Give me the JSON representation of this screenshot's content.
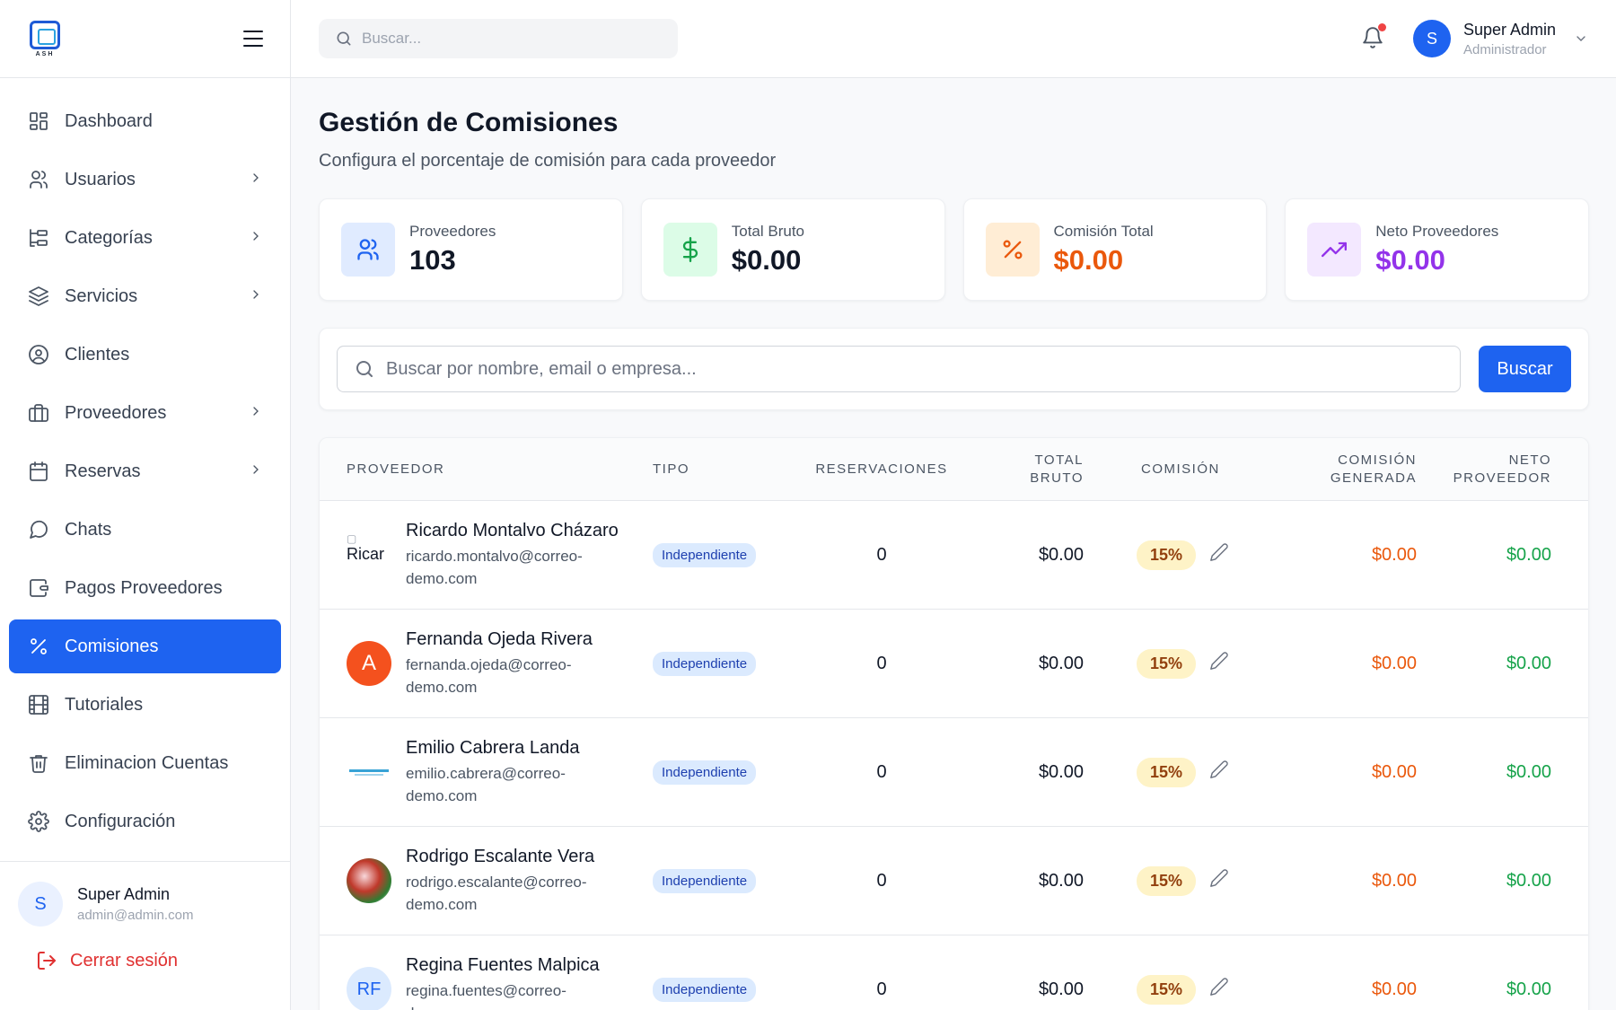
{
  "brand": {
    "logo_text": "ASH"
  },
  "sidebar": {
    "items": [
      {
        "label": "Dashboard",
        "icon": "dashboard-icon",
        "chevron": false,
        "active": false
      },
      {
        "label": "Usuarios",
        "icon": "users-icon",
        "chevron": true,
        "active": false
      },
      {
        "label": "Categorías",
        "icon": "categories-icon",
        "chevron": true,
        "active": false
      },
      {
        "label": "Servicios",
        "icon": "layers-icon",
        "chevron": true,
        "active": false
      },
      {
        "label": "Clientes",
        "icon": "user-circle-icon",
        "chevron": false,
        "active": false
      },
      {
        "label": "Proveedores",
        "icon": "briefcase-icon",
        "chevron": true,
        "active": false
      },
      {
        "label": "Reservas",
        "icon": "calendar-icon",
        "chevron": true,
        "active": false
      },
      {
        "label": "Chats",
        "icon": "chat-icon",
        "chevron": false,
        "active": false
      },
      {
        "label": "Pagos Proveedores",
        "icon": "wallet-icon",
        "chevron": false,
        "active": false
      },
      {
        "label": "Comisiones",
        "icon": "percent-icon",
        "chevron": false,
        "active": true
      },
      {
        "label": "Tutoriales",
        "icon": "film-icon",
        "chevron": false,
        "active": false
      },
      {
        "label": "Eliminacion Cuentas",
        "icon": "trash-icon",
        "chevron": false,
        "active": false
      },
      {
        "label": "Configuración",
        "icon": "gear-icon",
        "chevron": false,
        "active": false
      }
    ],
    "user": {
      "initial": "S",
      "name": "Super Admin",
      "email": "admin@admin.com"
    },
    "logout_label": "Cerrar sesión"
  },
  "header": {
    "search_placeholder": "Buscar...",
    "user": {
      "initial": "S",
      "name": "Super Admin",
      "role": "Administrador"
    }
  },
  "page": {
    "title": "Gestión de Comisiones",
    "subtitle": "Configura el porcentaje de comisión para cada proveedor"
  },
  "stats": [
    {
      "label": "Proveedores",
      "value": "103",
      "icon": "users-icon",
      "icon_bg": "#e0ebff",
      "icon_color": "#1e63f0",
      "value_color": "#111827"
    },
    {
      "label": "Total Bruto",
      "value": "$0.00",
      "icon": "dollar-icon",
      "icon_bg": "#dcfce7",
      "icon_color": "#16a34a",
      "value_color": "#111827"
    },
    {
      "label": "Comisión Total",
      "value": "$0.00",
      "icon": "percent-icon",
      "icon_bg": "#ffedd5",
      "icon_color": "#ea580c",
      "value_color": "#ea580c"
    },
    {
      "label": "Neto Proveedores",
      "value": "$0.00",
      "icon": "trending-up-icon",
      "icon_bg": "#f3e8ff",
      "icon_color": "#9333ea",
      "value_color": "#9333ea"
    }
  ],
  "filter": {
    "search_placeholder": "Buscar por nombre, email o empresa...",
    "button_label": "Buscar"
  },
  "table": {
    "headers": {
      "proveedor": "PROVEEDOR",
      "tipo": "TIPO",
      "reservaciones": "RESERVACIONES",
      "total_bruto_1": "TOTAL",
      "total_bruto_2": "BRUTO",
      "comision": "COMISIÓN",
      "comision_generada_1": "COMISIÓN",
      "comision_generada_2": "GENERADA",
      "neto_1": "NETO",
      "neto_2": "PROVEEDOR"
    },
    "rows": [
      {
        "name": "Ricardo Montalvo Cházaro",
        "email": "ricardo.montalvo@correo-demo.com",
        "avatar_type": "broken",
        "avatar_text": "Ricar",
        "tipo": "Independiente",
        "reservaciones": "0",
        "total_bruto": "$0.00",
        "comision": "15%",
        "comision_generada": "$0.00",
        "neto": "$0.00"
      },
      {
        "name": "Fernanda Ojeda Rivera",
        "email": "fernanda.ojeda@correo-demo.com",
        "avatar_type": "letter",
        "avatar_text": "A",
        "tipo": "Independiente",
        "reservaciones": "0",
        "total_bruto": "$0.00",
        "comision": "15%",
        "comision_generada": "$0.00",
        "neto": "$0.00"
      },
      {
        "name": "Emilio Cabrera Landa",
        "email": "emilio.cabrera@correo-demo.com",
        "avatar_type": "logo",
        "avatar_text": "",
        "tipo": "Independiente",
        "reservaciones": "0",
        "total_bruto": "$0.00",
        "comision": "15%",
        "comision_generada": "$0.00",
        "neto": "$0.00"
      },
      {
        "name": "Rodrigo Escalante Vera",
        "email": "rodrigo.escalante@correo-demo.com",
        "avatar_type": "photo",
        "avatar_text": "",
        "tipo": "Independiente",
        "reservaciones": "0",
        "total_bruto": "$0.00",
        "comision": "15%",
        "comision_generada": "$0.00",
        "neto": "$0.00"
      },
      {
        "name": "Regina Fuentes Malpica",
        "email": "regina.fuentes@correo-demo.com",
        "avatar_type": "initials",
        "avatar_text": "RF",
        "tipo": "Independiente",
        "reservaciones": "0",
        "total_bruto": "$0.00",
        "comision": "15%",
        "comision_generada": "$0.00",
        "neto": "$0.00"
      }
    ]
  }
}
